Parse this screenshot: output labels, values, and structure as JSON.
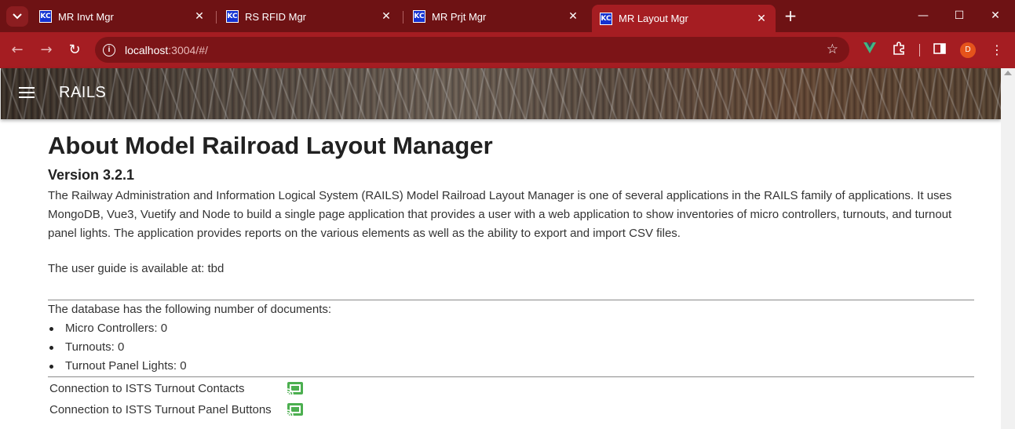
{
  "browser": {
    "tabs": [
      {
        "title": "MR Invt Mgr",
        "favicon": "KC",
        "active": false
      },
      {
        "title": "RS RFID Mgr",
        "favicon": "KC",
        "active": false
      },
      {
        "title": "MR Prjt Mgr",
        "favicon": "KC",
        "active": false
      },
      {
        "title": "MR Layout Mgr",
        "favicon": "KC",
        "active": true
      }
    ],
    "url_host": "localhost",
    "url_path": ":3004/#/",
    "avatar_initial": "D",
    "avatar_color": "#e5531b",
    "theme_color": "#a51d22"
  },
  "appbar": {
    "brand": "RAILS"
  },
  "page": {
    "title": "About Model Railroad Layout Manager",
    "version": "Version 3.2.1",
    "description": "The Railway Administration and Information Logical System (RAILS) Model Railroad Layout Manager is one of several applications in the RAILS family of applications. It uses MongoDB, Vue3, Vuetify and Node to build a single page application that provides a user with a web application to show inventories of micro controllers, turnouts, and turnout panel lights. The application provides reports on the various elements as well as the ability to export and import CSV files.",
    "user_guide": "The user guide is available at: tbd",
    "db_heading": "The database has the following number of documents:",
    "counts": [
      "Micro Controllers: 0",
      "Turnouts: 0",
      "Turnout Panel Lights: 0"
    ],
    "connections": [
      "Connection to ISTS Turnout Contacts",
      "Connection to ISTS Turnout Panel Buttons"
    ],
    "connection_icon_color": "#4caf50"
  }
}
